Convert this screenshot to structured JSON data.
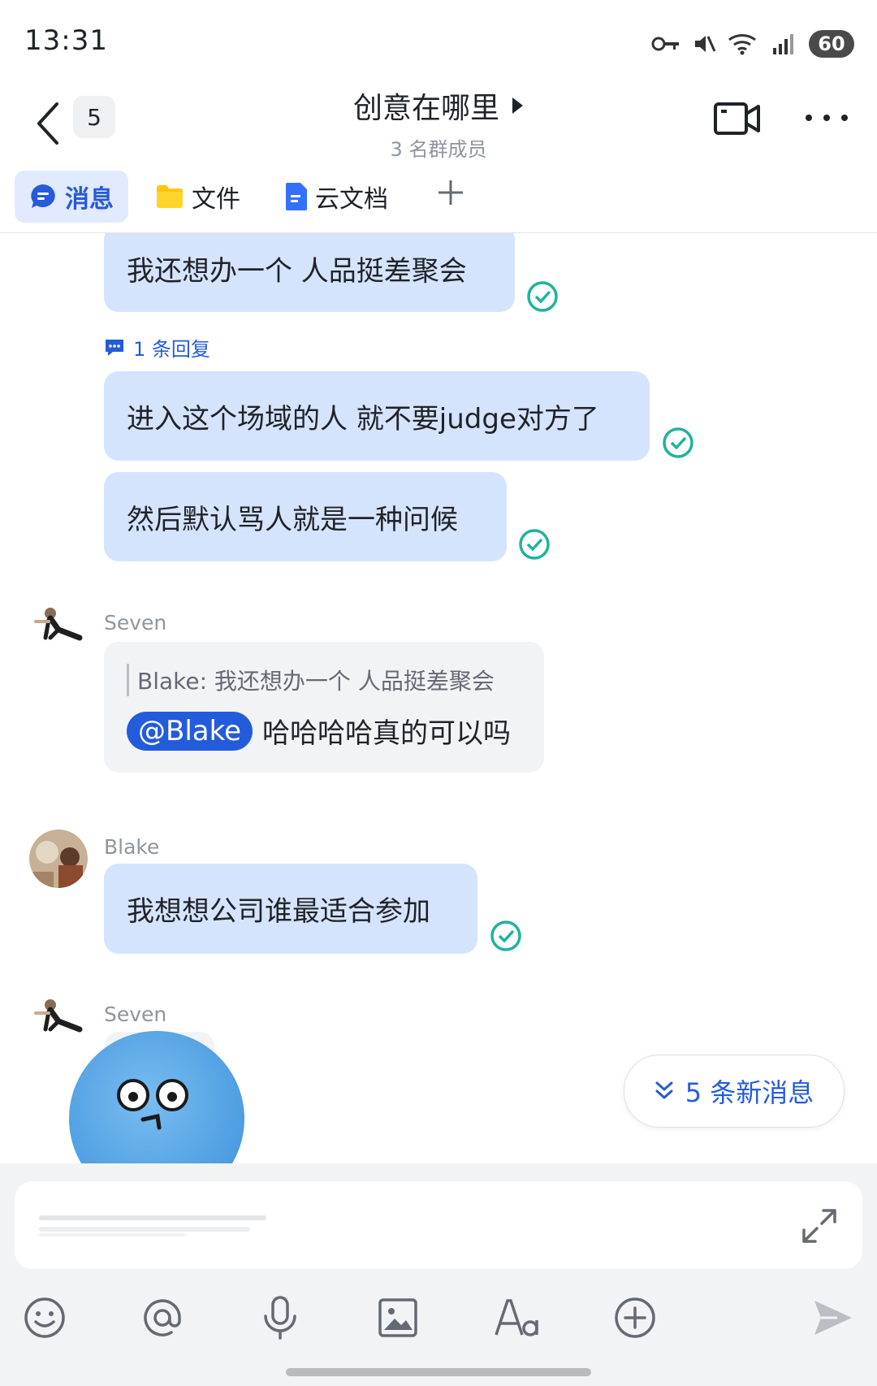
{
  "status_bar": {
    "time": "13:31",
    "battery": "60"
  },
  "header": {
    "back_count": "5",
    "title": "创意在哪里",
    "subtitle": "3 名群成员"
  },
  "tabs": [
    {
      "label": "消息",
      "icon": "chat-icon",
      "active": true
    },
    {
      "label": "文件",
      "icon": "folder-icon",
      "active": false
    },
    {
      "label": "云文档",
      "icon": "doc-icon",
      "active": false
    }
  ],
  "messages": {
    "m1": "我还想办一个 人品挺差聚会",
    "reply_count": "1 条回复",
    "m2": "进入这个场域的人 就不要judge对方了",
    "m3": "然后默认骂人就是一种问候",
    "seven1": {
      "sender": "Seven",
      "quote": "Blake: 我还想办一个 人品挺差聚会",
      "mention": "@Blake",
      "text": "哈哈哈哈真的可以吗"
    },
    "blake1": {
      "sender": "Blake",
      "text": "我想想公司谁最适合参加"
    },
    "seven2": {
      "sender": "Seven"
    }
  },
  "new_messages": "5 条新消息",
  "colors": {
    "accent": "#245bdb",
    "my_bubble": "#d5e4fd",
    "read_check": "#1fb39a"
  },
  "toolbar_icons": [
    "emoji-icon",
    "at-icon",
    "mic-icon",
    "image-icon",
    "font-icon",
    "plus-icon",
    "send-icon"
  ]
}
